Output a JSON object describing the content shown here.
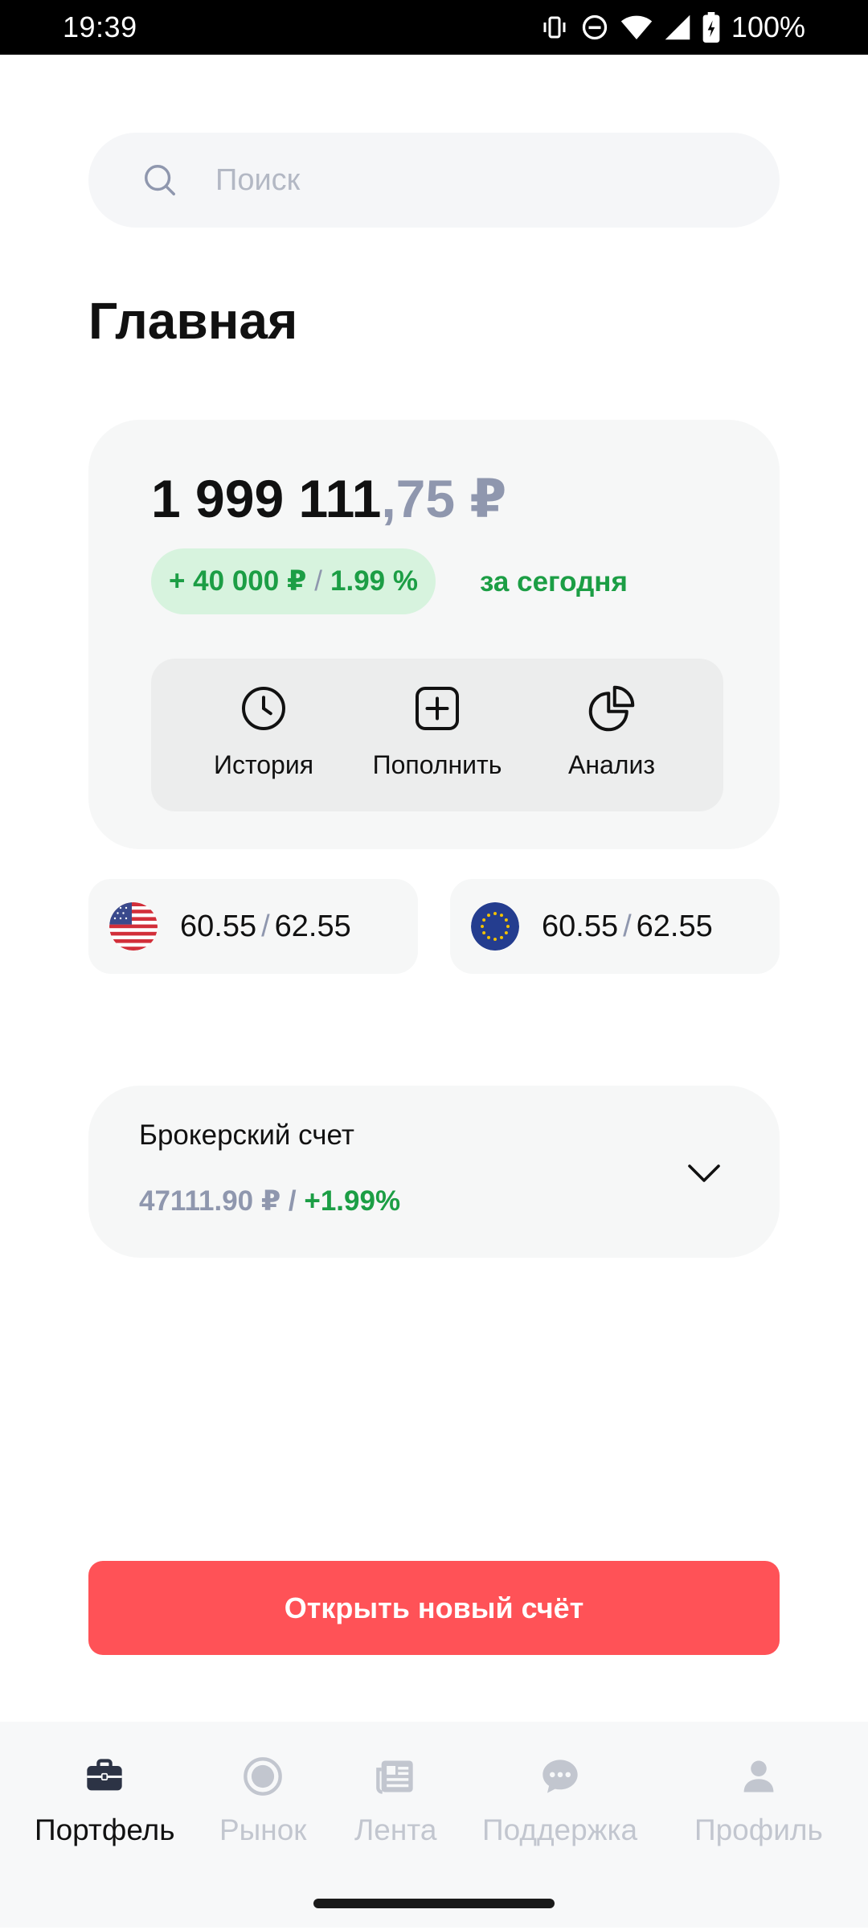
{
  "status_bar": {
    "time": "19:39",
    "battery": "100%"
  },
  "search": {
    "placeholder": "Поиск"
  },
  "page_title": "Главная",
  "balance": {
    "whole": "1 999 111",
    "cents": ",75 ₽",
    "change_amount": "+ 40 000 ₽",
    "change_sep": "/",
    "change_percent": "1.99 %",
    "period": "за сегодня",
    "colors": {
      "positive": "#1c9e45",
      "muted": "#8f97ae"
    }
  },
  "actions": [
    {
      "label": "История",
      "icon": "clock-icon"
    },
    {
      "label": "Пополнить",
      "icon": "plus-square-icon"
    },
    {
      "label": "Анализ",
      "icon": "pie-chart-icon"
    }
  ],
  "rates": [
    {
      "flag": "us-flag-icon",
      "buy": "60.55",
      "sep": "/",
      "sell": "62.55"
    },
    {
      "flag": "eu-flag-icon",
      "buy": "60.55",
      "sep": "/",
      "sell": "62.55"
    }
  ],
  "broker_account": {
    "name": "Брокерский счет",
    "sum": "47111.90 ₽",
    "sep": " / ",
    "percent": "+1.99%"
  },
  "open_account_button": {
    "label": "Открыть новый счёт",
    "color": "#ff5257"
  },
  "bottom_nav": [
    {
      "label": "Портфель",
      "icon": "briefcase-icon",
      "active": true
    },
    {
      "label": "Рынок",
      "icon": "radio-circle-icon",
      "active": false
    },
    {
      "label": "Лента",
      "icon": "newspaper-icon",
      "active": false
    },
    {
      "label": "Поддержка",
      "icon": "chat-bubble-icon",
      "active": false
    },
    {
      "label": "Профиль",
      "icon": "person-icon",
      "active": false
    }
  ]
}
